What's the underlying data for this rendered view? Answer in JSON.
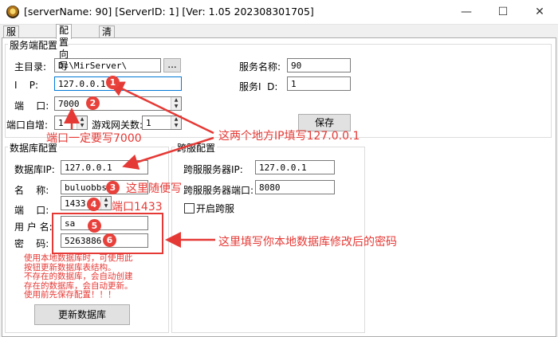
{
  "window": {
    "title": "[serverName: 90] [ServerID: 1] [Ver: 1.05 202308301705]",
    "minimize_label": "—",
    "maximize_label": "☐",
    "close_label": "✕"
  },
  "tabs": [
    "服务端控制",
    "配置向导",
    "清理数据"
  ],
  "server_config": {
    "group_title": "服务端配置",
    "root_dir_label": "主目录:",
    "root_dir_value": "D:\\MirServer\\",
    "browse_label": "...",
    "ip_label": "I    P:",
    "ip_value": "127.0.0.1",
    "port_label": "端    口:",
    "port_value": "7000",
    "port_auto_label": "端口自增:",
    "port_auto_value": "1",
    "gateway_label": "游戏网关数:",
    "gateway_value": "1",
    "server_name_label": "服务名称:",
    "server_name_value": "90",
    "server_id_label": "服务I  D:",
    "server_id_value": "1",
    "save_label": "保存"
  },
  "db_config": {
    "group_title": "数据库配置",
    "db_ip_label": "数据库IP:",
    "db_ip_value": "127.0.0.1",
    "name_label": "名    称:",
    "name_value": "buluobbs",
    "port_label": "端    口:",
    "port_value": "1433",
    "user_label": "用 户 名:",
    "user_value": "sa",
    "password_label": "密    码:",
    "password_value": "5263886",
    "notes": [
      "使用本地数据库时，可使用此",
      "按钮更新数据库表结构。",
      "不存在的数据库，会自动创建",
      "存在的数据库，会自动更新。",
      "使用前先保存配置！！！"
    ],
    "update_db_label": "更新数据库"
  },
  "cross_config": {
    "group_title": "跨服配置",
    "cross_ip_label": "跨服服务器IP:",
    "cross_ip_value": "127.0.0.1",
    "cross_port_label": "跨服服务器端口:",
    "cross_port_value": "8080",
    "enable_label": "开启跨服"
  },
  "annotations": {
    "badges": [
      "1",
      "2",
      "3",
      "4",
      "5",
      "6"
    ],
    "port_must": "端口一定要写7000",
    "ip_note": "这两个地方IP填写127.0.0.1",
    "name_note": "这里随便写",
    "db_port_note": "端口1433",
    "password_note": "这里填写你本地数据库修改后的密码",
    "accent_color": "#e53935"
  }
}
